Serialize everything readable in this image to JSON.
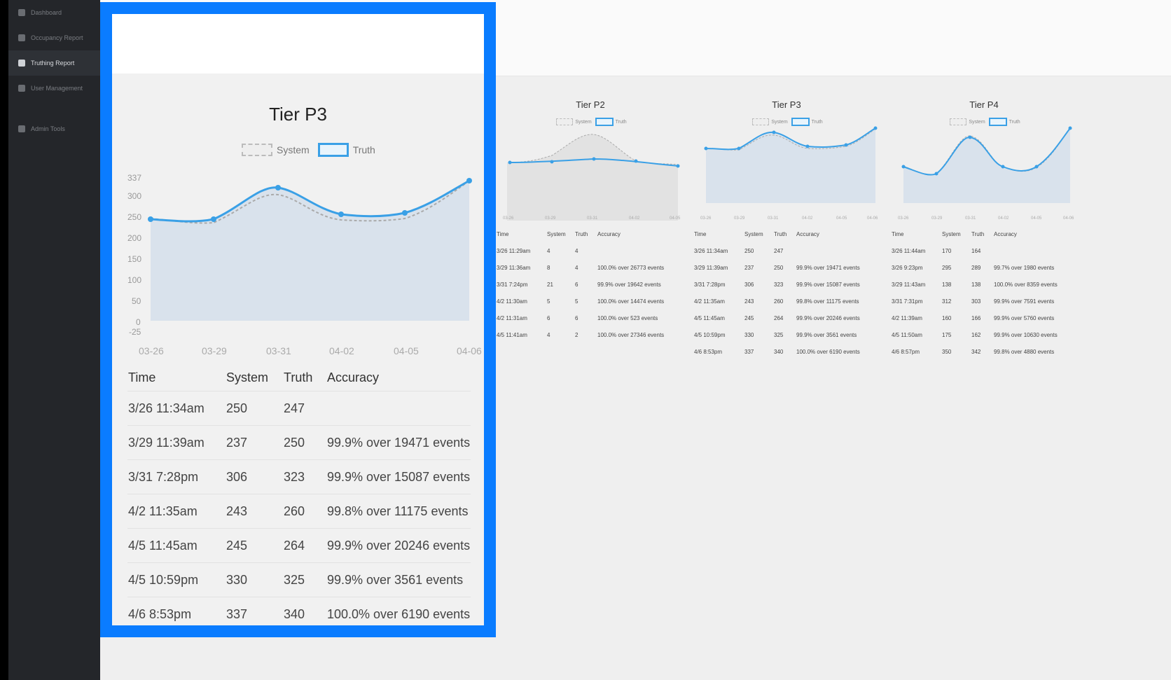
{
  "sidebar": {
    "items": [
      {
        "label": "Dashboard"
      },
      {
        "label": "Occupancy Report"
      },
      {
        "label": "Truthing Report"
      },
      {
        "label": "User Management"
      },
      {
        "label": "Admin Tools"
      }
    ]
  },
  "table_headers": [
    "Time",
    "System",
    "Truth",
    "Accuracy"
  ],
  "legend": {
    "system": "System",
    "truth": "Truth"
  },
  "charts": [
    {
      "title": "Tier P2",
      "x_ticks": [
        "03-26",
        "03-29",
        "03-31",
        "04-02",
        "04-05"
      ],
      "rows": [
        [
          "3/26 11:29am",
          "4",
          "4",
          ""
        ],
        [
          "3/29 11:36am",
          "8",
          "4",
          "100.0% over 26773 events"
        ],
        [
          "3/31 7:24pm",
          "21",
          "6",
          "99.9% over 19642 events"
        ],
        [
          "4/2 11:30am",
          "5",
          "5",
          "100.0% over 14474 events"
        ],
        [
          "4/2 11:31am",
          "6",
          "6",
          "100.0% over 523 events"
        ],
        [
          "4/5 11:41am",
          "4",
          "2",
          "100.0% over 27346 events"
        ]
      ]
    },
    {
      "title": "Tier P3",
      "x_ticks": [
        "03-26",
        "03-29",
        "03-31",
        "04-02",
        "04-05",
        "04-06"
      ],
      "y_ticks": [
        "337",
        "300",
        "250",
        "200",
        "150",
        "100",
        "50",
        "0",
        "-25"
      ],
      "rows": [
        [
          "3/26 11:34am",
          "250",
          "247",
          ""
        ],
        [
          "3/29 11:39am",
          "237",
          "250",
          "99.9% over 19471 events"
        ],
        [
          "3/31 7:28pm",
          "306",
          "323",
          "99.9% over 15087 events"
        ],
        [
          "4/2 11:35am",
          "243",
          "260",
          "99.8% over 11175 events"
        ],
        [
          "4/5 11:45am",
          "245",
          "264",
          "99.9% over 20246 events"
        ],
        [
          "4/5 10:59pm",
          "330",
          "325",
          "99.9% over 3561 events"
        ],
        [
          "4/6 8:53pm",
          "337",
          "340",
          "100.0% over 6190 events"
        ]
      ]
    },
    {
      "title": "Tier P4",
      "x_ticks": [
        "03-26",
        "03-29",
        "03-31",
        "04-02",
        "04-05",
        "04-06"
      ],
      "rows": [
        [
          "3/26 11:44am",
          "170",
          "164",
          ""
        ],
        [
          "3/26 9:23pm",
          "295",
          "289",
          "99.7% over 1980 events"
        ],
        [
          "3/29 11:43am",
          "138",
          "138",
          "100.0% over 8359 events"
        ],
        [
          "3/31 7:31pm",
          "312",
          "303",
          "99.9% over 7591 events"
        ],
        [
          "4/2 11:39am",
          "160",
          "166",
          "99.9% over 5760 events"
        ],
        [
          "4/5 11:50am",
          "175",
          "162",
          "99.9% over 10630 events"
        ],
        [
          "4/6 8:57pm",
          "350",
          "342",
          "99.8% over 4880 events"
        ]
      ]
    }
  ],
  "colors": {
    "truth": "#3aa0e6",
    "system": "#aaaaaa",
    "area": "#d9e2ec",
    "highlight": "#0a7cff"
  }
}
